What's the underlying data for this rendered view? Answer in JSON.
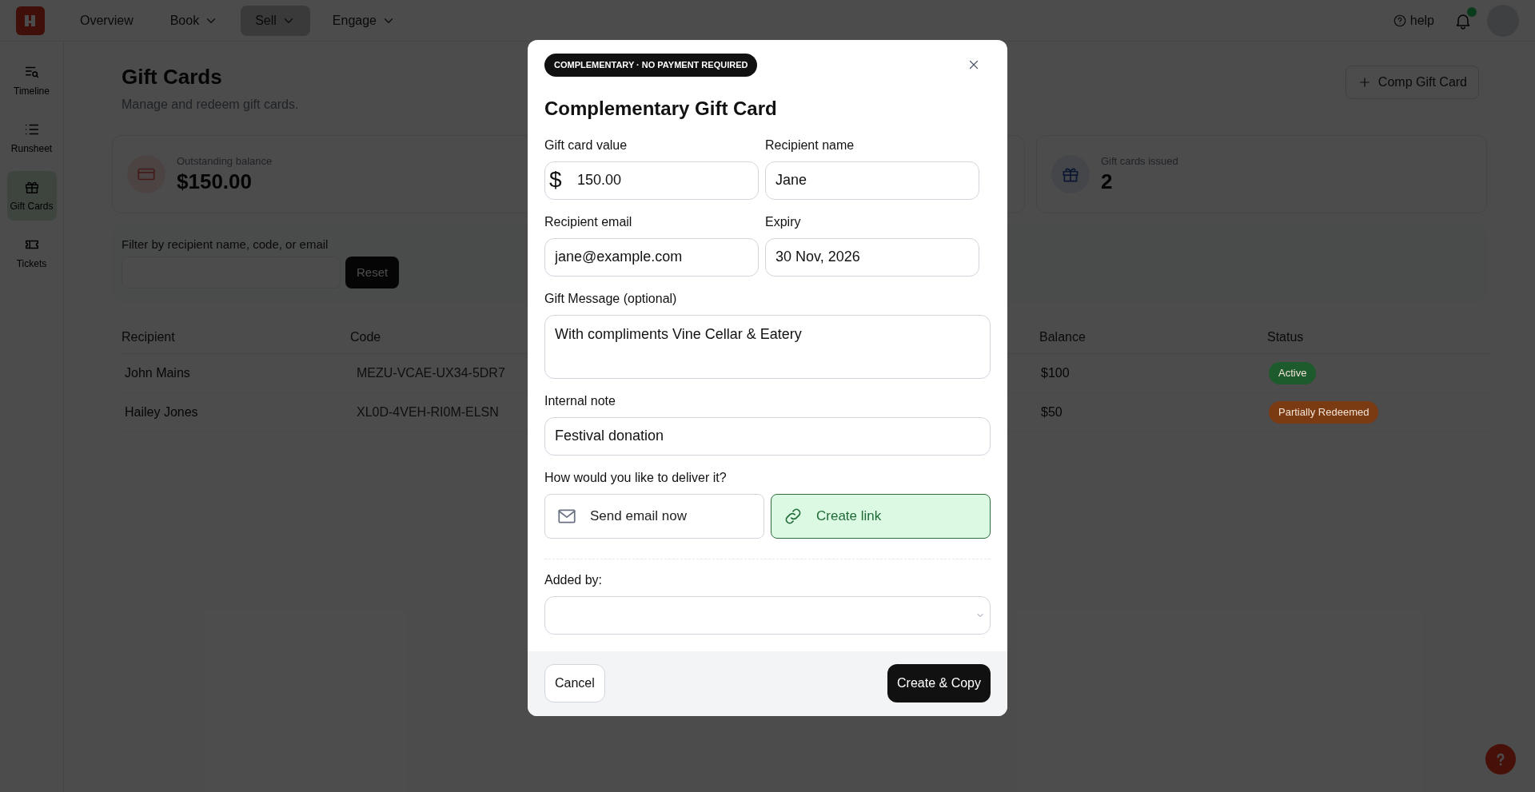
{
  "nav": {
    "items": [
      {
        "label": "Overview",
        "dropdown": false,
        "selected": false
      },
      {
        "label": "Book",
        "dropdown": true,
        "selected": false
      },
      {
        "label": "Sell",
        "dropdown": true,
        "selected": true
      },
      {
        "label": "Engage",
        "dropdown": true,
        "selected": false
      }
    ],
    "help": "help"
  },
  "sidebar": {
    "items": [
      {
        "label": "Timeline",
        "selected": false
      },
      {
        "label": "Runsheet",
        "selected": false
      },
      {
        "label": "Gift Cards",
        "selected": true
      },
      {
        "label": "Tickets",
        "selected": false
      }
    ]
  },
  "page": {
    "title": "Gift Cards",
    "subtitle": "Manage and redeem gift cards.",
    "action": "Comp Gift Card",
    "stats": [
      {
        "label": "Outstanding balance",
        "value": "$150.00"
      },
      {
        "label": "Gift cards issued",
        "value": "2"
      }
    ],
    "filter": {
      "label": "Filter by recipient name, code, or email",
      "button": "Reset"
    },
    "table": {
      "columns": [
        "Recipient",
        "Code",
        "Balance",
        "Status"
      ],
      "rows": [
        {
          "recipient": "John Mains",
          "code": "MEZU-VCAE-UX34-5DR7",
          "balance": "$100",
          "status": "Active",
          "color": "#1e5b2c"
        },
        {
          "recipient": "Hailey Jones",
          "code": "XL0D-4VEH-RI0M-ELSN",
          "balance": "$50",
          "status": "Partially Redeemed",
          "color": "#7a3a12"
        }
      ]
    }
  },
  "modal": {
    "badge": "COMPLEMENTARY · NO PAYMENT REQUIRED",
    "title": "Complementary Gift Card",
    "fields": [
      {
        "label": "Gift card value",
        "prefix": "$",
        "value": "150.00"
      },
      {
        "label": "Recipient name",
        "value": "Jane"
      },
      {
        "label": "Recipient email",
        "value": "jane@example.com"
      },
      {
        "label": "Expiry",
        "value": "30 Nov, 2026"
      }
    ],
    "message": {
      "label": "Gift Message (optional)",
      "value": "With compliments Vine Cellar & Eatery"
    },
    "note": {
      "label": "Internal note",
      "value": "Festival donation"
    },
    "delivery": {
      "label": "How would you like to deliver it?",
      "options": [
        {
          "label": "Send email now",
          "selected": false
        },
        {
          "label": "Create link",
          "selected": true
        }
      ]
    },
    "added_by": {
      "label": "Added by:"
    },
    "cancel": "Cancel",
    "submit": "Create & Copy"
  }
}
